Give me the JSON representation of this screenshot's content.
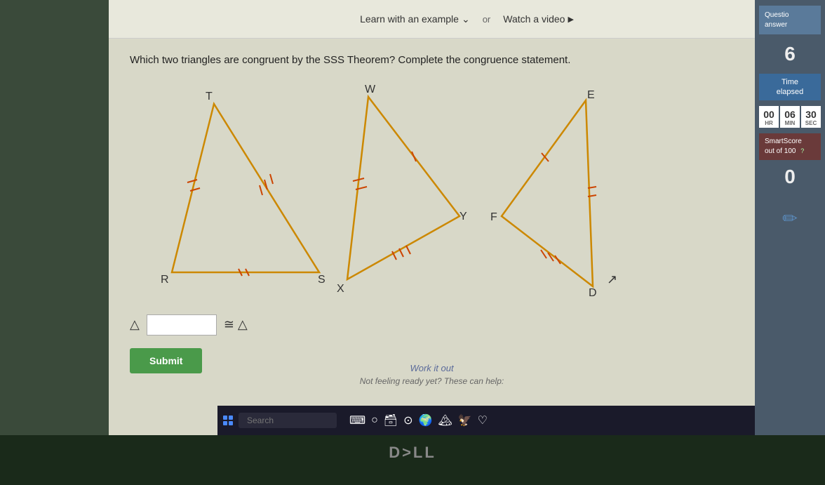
{
  "header": {
    "learn_label": "Learn with an example",
    "or_label": "or",
    "watch_label": "Watch a video",
    "watch_icon": "▶"
  },
  "question": {
    "text": "Which two triangles are congruent by the SSS Theorem? Complete the congruence statement."
  },
  "triangles": {
    "triangle1": {
      "vertices": {
        "T": "T",
        "R": "R",
        "S": "S"
      }
    },
    "triangle2": {
      "vertices": {
        "W": "W",
        "X": "X",
        "Y": "Y"
      }
    },
    "triangle3": {
      "vertices": {
        "E": "E",
        "D": "D",
        "F": "F"
      }
    }
  },
  "answer": {
    "triangle_symbol": "△",
    "input_placeholder": "",
    "congruent_symbol": "≅ △",
    "submit_label": "Submit"
  },
  "bottom": {
    "work_it_out": "Work it out",
    "not_feeling": "Not feeling ready yet? These can help:"
  },
  "right_panel": {
    "questions_label": "Questio\nanswer",
    "questions_count": "6",
    "time_elapsed_label": "Time\nelapsed",
    "timer": {
      "hours": "00",
      "minutes": "06",
      "seconds": "30",
      "hr_label": "HR",
      "min_label": "MIN",
      "sec_label": "SEC"
    },
    "smart_score_label": "SmartScore\nout of 100",
    "smart_score": "0"
  },
  "taskbar": {
    "search_placeholder": "Search",
    "icons": [
      "🌐",
      "○",
      "🗂",
      "⊙",
      "🌍",
      "🏔",
      "🦅",
      "♡",
      "🌐"
    ]
  }
}
